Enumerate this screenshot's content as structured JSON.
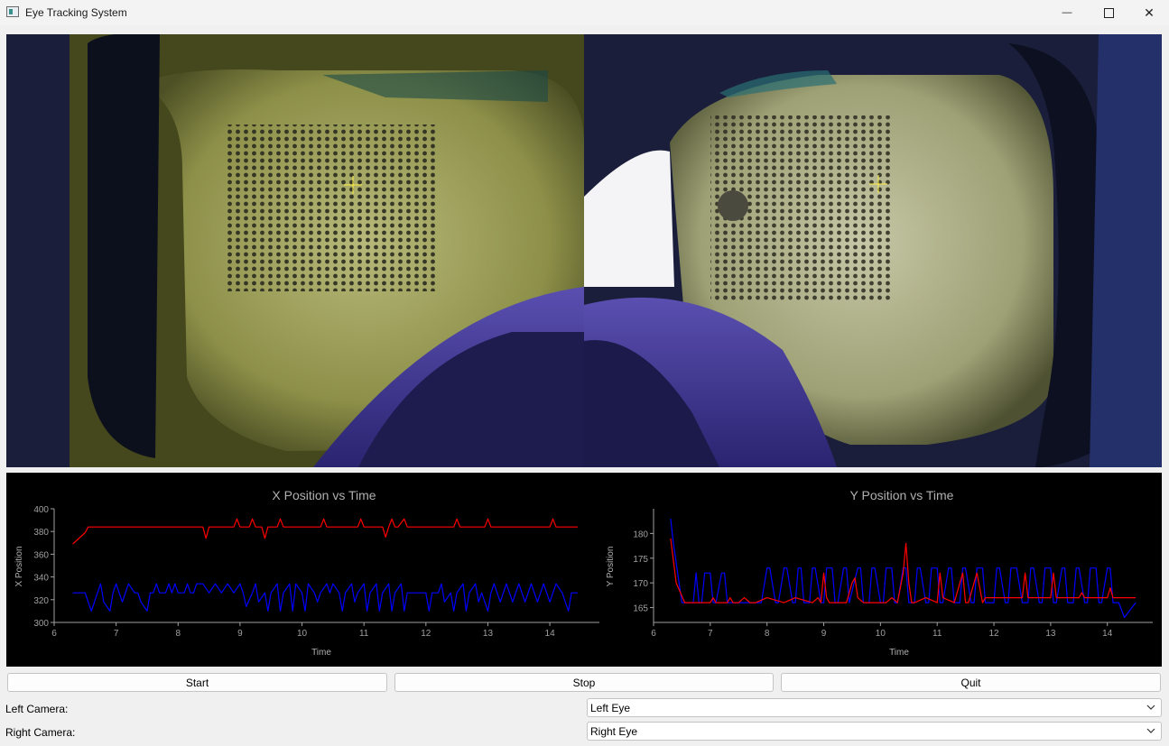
{
  "window": {
    "title": "Eye Tracking System",
    "minimize_glyph": "—",
    "close_glyph": "✕"
  },
  "camera": {
    "icons": [
      "crosshair-icon",
      "crosshair-icon"
    ],
    "crosshair_color": "#ffee44"
  },
  "chart_data": [
    {
      "type": "line",
      "title": "X Position vs Time",
      "xlabel": "Time",
      "ylabel": "X Position",
      "xlim": [
        6,
        14.8
      ],
      "ylim": [
        300,
        400
      ],
      "xticks": [
        6,
        7,
        8,
        9,
        10,
        11,
        12,
        13,
        14
      ],
      "yticks": [
        300,
        320,
        340,
        360,
        380,
        400
      ],
      "series": [
        {
          "color": "#ff0000",
          "x": [
            6.3,
            6.5,
            6.55,
            8.4,
            8.45,
            8.5,
            8.9,
            8.95,
            9.0,
            9.15,
            9.2,
            9.25,
            9.35,
            9.4,
            9.45,
            9.6,
            9.65,
            9.7,
            10.3,
            10.35,
            10.4,
            10.9,
            10.95,
            11.0,
            11.3,
            11.35,
            11.4,
            11.45,
            11.5,
            11.55,
            11.65,
            11.7,
            11.75,
            12.45,
            12.5,
            12.55,
            12.95,
            13.0,
            13.05,
            14.0,
            14.05,
            14.1,
            14.45
          ],
          "values": [
            369,
            379,
            384,
            384,
            374,
            384,
            384,
            391,
            384,
            384,
            391,
            384,
            384,
            374,
            384,
            384,
            391,
            384,
            384,
            391,
            384,
            384,
            391,
            384,
            384,
            375,
            384,
            391,
            384,
            384,
            391,
            384,
            384,
            384,
            391,
            384,
            384,
            391,
            384,
            384,
            391,
            384,
            384
          ]
        },
        {
          "color": "#0000ff",
          "x": [
            6.3,
            6.5,
            6.55,
            6.6,
            6.7,
            6.75,
            6.8,
            6.9,
            6.95,
            7.0,
            7.1,
            7.15,
            7.2,
            7.3,
            7.35,
            7.4,
            7.5,
            7.55,
            7.6,
            7.65,
            7.7,
            7.8,
            7.85,
            7.9,
            7.95,
            8.0,
            8.1,
            8.15,
            8.2,
            8.25,
            8.3,
            8.4,
            8.5,
            8.6,
            8.7,
            8.8,
            8.9,
            9.0,
            9.05,
            9.1,
            9.2,
            9.25,
            9.3,
            9.4,
            9.45,
            9.5,
            9.6,
            9.65,
            9.7,
            9.8,
            9.85,
            9.9,
            10.0,
            10.05,
            10.1,
            10.2,
            10.25,
            10.3,
            10.4,
            10.45,
            10.5,
            10.6,
            10.65,
            10.7,
            10.8,
            10.85,
            10.9,
            11.0,
            11.05,
            11.1,
            11.2,
            11.25,
            11.3,
            11.4,
            11.45,
            11.5,
            11.6,
            11.65,
            11.7,
            12.0,
            12.05,
            12.1,
            12.2,
            12.25,
            12.3,
            12.4,
            12.45,
            12.5,
            12.6,
            12.65,
            12.7,
            12.8,
            12.85,
            12.9,
            13.0,
            13.05,
            13.1,
            13.2,
            13.25,
            13.3,
            13.4,
            13.45,
            13.5,
            13.6,
            13.65,
            13.7,
            13.8,
            13.85,
            13.9,
            14.0,
            14.05,
            14.1,
            14.2,
            14.25,
            14.3,
            14.35,
            14.4,
            14.45
          ],
          "values": [
            326,
            326,
            318,
            310,
            326,
            334,
            318,
            310,
            326,
            334,
            318,
            326,
            334,
            326,
            326,
            318,
            310,
            326,
            326,
            334,
            326,
            326,
            334,
            326,
            334,
            326,
            326,
            334,
            326,
            326,
            334,
            334,
            326,
            334,
            326,
            334,
            326,
            334,
            326,
            314,
            326,
            334,
            318,
            326,
            310,
            326,
            334,
            310,
            326,
            334,
            310,
            334,
            326,
            310,
            334,
            326,
            318,
            326,
            334,
            326,
            334,
            326,
            310,
            326,
            334,
            318,
            326,
            334,
            310,
            326,
            334,
            310,
            326,
            334,
            310,
            326,
            334,
            310,
            326,
            326,
            310,
            326,
            326,
            334,
            318,
            326,
            310,
            326,
            334,
            310,
            326,
            334,
            318,
            326,
            310,
            326,
            334,
            318,
            326,
            334,
            318,
            326,
            334,
            318,
            326,
            334,
            318,
            326,
            334,
            318,
            326,
            334,
            326,
            318,
            310,
            326,
            326,
            326
          ]
        }
      ]
    },
    {
      "type": "line",
      "title": "Y Position vs Time",
      "xlabel": "Time",
      "ylabel": "Y Position",
      "xlim": [
        6,
        14.8
      ],
      "ylim": [
        162,
        185
      ],
      "xticks": [
        6,
        7,
        8,
        9,
        10,
        11,
        12,
        13,
        14
      ],
      "yticks": [
        165,
        170,
        175,
        180
      ],
      "series": [
        {
          "color": "#0000ff",
          "x": [
            6.3,
            6.35,
            6.5,
            6.6,
            6.7,
            6.75,
            6.8,
            6.85,
            6.9,
            7.0,
            7.05,
            7.1,
            7.2,
            7.25,
            7.3,
            7.35,
            7.4,
            7.6,
            7.7,
            7.8,
            7.9,
            8.0,
            8.05,
            8.15,
            8.2,
            8.3,
            8.35,
            8.45,
            8.5,
            8.55,
            8.6,
            8.65,
            8.75,
            8.8,
            8.85,
            8.95,
            9.0,
            9.05,
            9.15,
            9.2,
            9.25,
            9.35,
            9.4,
            9.45,
            9.6,
            9.65,
            9.7,
            9.8,
            9.85,
            9.9,
            10.0,
            10.05,
            10.1,
            10.2,
            10.25,
            10.3,
            10.4,
            10.45,
            10.5,
            10.6,
            10.65,
            10.7,
            10.8,
            10.85,
            10.9,
            11.0,
            11.05,
            11.1,
            11.2,
            11.25,
            11.3,
            11.4,
            11.45,
            11.5,
            11.6,
            11.65,
            11.7,
            11.8,
            11.85,
            11.9,
            12.0,
            12.05,
            12.1,
            12.2,
            12.25,
            12.3,
            12.4,
            12.5,
            12.6,
            12.65,
            12.7,
            12.8,
            12.85,
            12.9,
            13.0,
            13.05,
            13.1,
            13.2,
            13.25,
            13.3,
            13.4,
            13.45,
            13.5,
            13.6,
            13.65,
            13.7,
            13.8,
            13.85,
            13.9,
            14.0,
            14.05,
            14.1,
            14.2,
            14.3,
            14.5
          ],
          "values": [
            183,
            178,
            166,
            166,
            166,
            172,
            166,
            166,
            172,
            172,
            166,
            166,
            172,
            172,
            166,
            166,
            166,
            166,
            166,
            166,
            166,
            173,
            173,
            166,
            166,
            173,
            173,
            166,
            166,
            173,
            173,
            166,
            166,
            173,
            173,
            166,
            166,
            173,
            173,
            166,
            166,
            173,
            173,
            166,
            173,
            173,
            166,
            166,
            173,
            173,
            166,
            166,
            173,
            173,
            166,
            166,
            173,
            173,
            166,
            166,
            173,
            173,
            166,
            166,
            173,
            173,
            166,
            166,
            173,
            173,
            166,
            166,
            173,
            173,
            166,
            166,
            173,
            173,
            166,
            166,
            166,
            173,
            173,
            166,
            166,
            173,
            173,
            166,
            166,
            173,
            173,
            166,
            166,
            173,
            173,
            166,
            166,
            173,
            173,
            166,
            166,
            173,
            173,
            166,
            166,
            173,
            173,
            166,
            166,
            173,
            173,
            166,
            166,
            163,
            166
          ]
        },
        {
          "color": "#ff0000",
          "x": [
            6.3,
            6.4,
            6.55,
            6.6,
            7.0,
            7.05,
            7.1,
            7.3,
            7.35,
            7.4,
            7.5,
            7.6,
            7.7,
            7.8,
            8.0,
            8.3,
            8.5,
            8.8,
            8.9,
            8.95,
            9.0,
            9.05,
            9.1,
            9.4,
            9.5,
            9.55,
            9.6,
            9.7,
            10.1,
            10.2,
            10.3,
            10.4,
            10.45,
            10.5,
            10.55,
            10.6,
            10.8,
            11.0,
            11.05,
            11.1,
            11.3,
            11.45,
            11.5,
            11.55,
            11.7,
            11.8,
            11.85,
            12.0,
            12.5,
            12.55,
            12.6,
            13.0,
            13.05,
            13.1,
            13.5,
            13.55,
            13.6,
            14.0,
            14.05,
            14.1,
            14.5
          ],
          "values": [
            179,
            170,
            166,
            166,
            166,
            167,
            166,
            166,
            167,
            166,
            166,
            167,
            166,
            166,
            167,
            166,
            167,
            166,
            167,
            166,
            172,
            167,
            166,
            166,
            170,
            171,
            167,
            166,
            166,
            167,
            166,
            172,
            178,
            170,
            166,
            166,
            167,
            166,
            172,
            167,
            166,
            172,
            166,
            166,
            172,
            166,
            167,
            167,
            167,
            172,
            167,
            167,
            172,
            167,
            167,
            168,
            167,
            167,
            169,
            167,
            167
          ]
        }
      ]
    }
  ],
  "controls": {
    "start_label": "Start",
    "stop_label": "Stop",
    "quit_label": "Quit",
    "left_camera_label": "Left Camera:",
    "right_camera_label": "Right Camera:",
    "left_camera_value": "Left Eye",
    "right_camera_value": "Right Eye"
  }
}
